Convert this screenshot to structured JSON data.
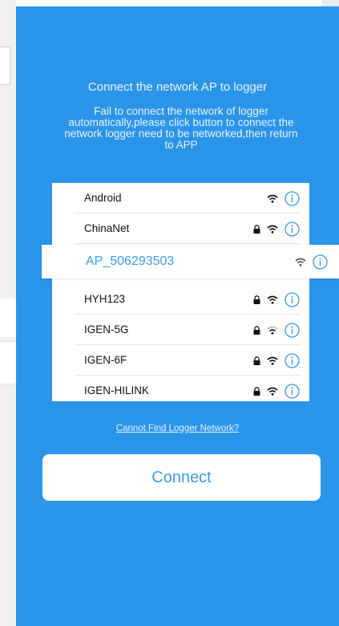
{
  "header": {
    "title": "Connect the network AP to logger",
    "description": "Fail to connect the network of logger automatically,please click button to connect the network logger need to be networked,then return to APP"
  },
  "networks": [
    {
      "ssid": "Android",
      "locked": false
    },
    {
      "ssid": "ChinaNet",
      "locked": true
    },
    {
      "ssid": "AP_506293503",
      "locked": false,
      "selected": true
    },
    {
      "ssid": "HYH123",
      "locked": true
    },
    {
      "ssid": "IGEN-5G",
      "locked": true
    },
    {
      "ssid": "IGEN-6F",
      "locked": true
    },
    {
      "ssid": "IGEN-HILINK",
      "locked": true
    }
  ],
  "footer": {
    "help_link": "Cannot Find Logger Network?",
    "connect_label": "Connect"
  },
  "colors": {
    "panel_background": "#2b95ea",
    "accent_text": "#3a9ae8",
    "icon_blue": "#3a9ae8"
  },
  "icons": {
    "wifi": "wifi-icon",
    "lock": "lock-icon",
    "info": "info-icon"
  }
}
